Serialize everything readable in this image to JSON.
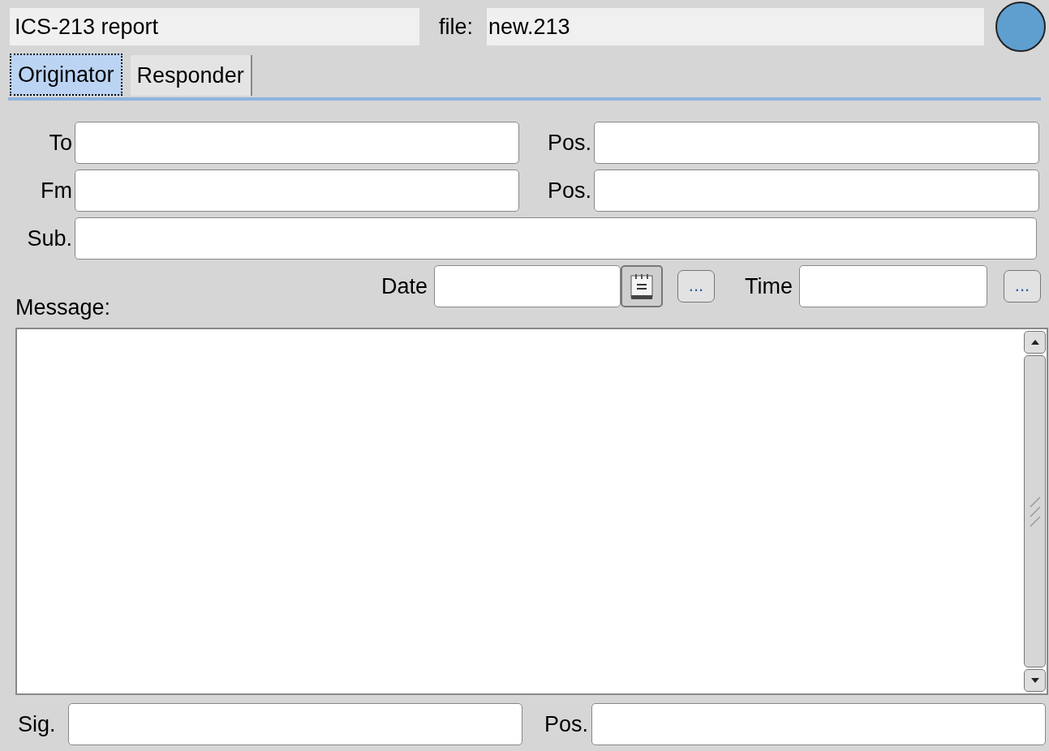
{
  "header": {
    "title": "ICS-213 report",
    "file_label": "file:",
    "file_name": "new.213"
  },
  "tabs": [
    {
      "label": "Originator",
      "selected": true
    },
    {
      "label": "Responder",
      "selected": false
    }
  ],
  "to": {
    "label": "To",
    "pos_label": "Pos."
  },
  "from": {
    "label": "Fm",
    "pos_label": "Pos."
  },
  "subject": {
    "label": "Sub."
  },
  "date": {
    "label": "Date",
    "button": "..."
  },
  "time": {
    "label": "Time",
    "button": "..."
  },
  "message": {
    "label": "Message:"
  },
  "signature": {
    "label": "Sig.",
    "pos_label": "Pos."
  }
}
